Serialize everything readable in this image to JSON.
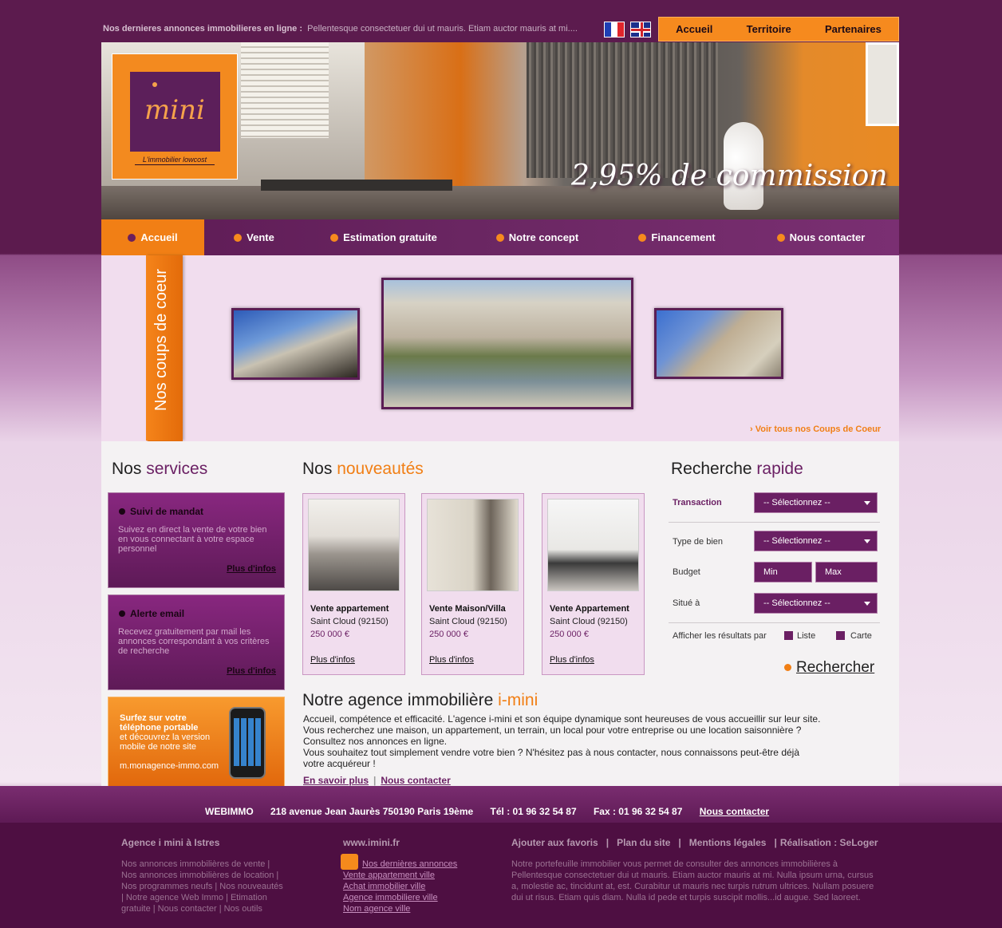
{
  "top": {
    "headline_label": "Nos dernieres annonces immobilieres en ligne",
    "headline_sep": " :",
    "headline_text": "Pellentesque consectetuer dui ut mauris. Etiam auctor mauris at mi....",
    "nav": [
      "Accueil",
      "Territoire",
      "Partenaires"
    ]
  },
  "hero": {
    "logo_word": "mini",
    "logo_tagline": "L'immobilier lowcost",
    "commission": "2,95% de commission"
  },
  "mainnav": [
    "Accueil",
    "Vente",
    "Estimation gratuite",
    "Notre concept",
    "Financement",
    "Nous contacter"
  ],
  "coeur": {
    "tab": "Nos coups de coeur",
    "link": "› Voir tous nos Coups de Coeur"
  },
  "services": {
    "title_a": "Nos ",
    "title_b": "services",
    "items": [
      {
        "title": "Suivi de mandat",
        "desc": "Suivez en direct la vente de votre bien en vous connectant à votre espace personnel",
        "more": "Plus d'infos"
      },
      {
        "title": "Alerte email",
        "desc": "Recevez gratuitement par mail les annonces correspondant à vos critères de recherche",
        "more": "Plus d'infos"
      }
    ],
    "mobile": {
      "title": "Surfez sur votre téléphone portable",
      "desc": "et découvrez la version mobile de notre site",
      "url": "m.monagence-immo.com"
    }
  },
  "nouveautes": {
    "title_a": "Nos ",
    "title_b": "nouveautés",
    "cards": [
      {
        "title": "Vente appartement",
        "city": "Saint Cloud  (92150)",
        "price": "250 000 €",
        "more": "Plus d'infos"
      },
      {
        "title": "Vente Maison/Villa",
        "city": "Saint Cloud  (92150)",
        "price": "250 000 €",
        "more": "Plus d'infos"
      },
      {
        "title": "Vente Appartement",
        "city": "Saint Cloud  (92150)",
        "price": "250 000 €",
        "more": "Plus d'infos"
      }
    ]
  },
  "recherche": {
    "title_a": "Recherche ",
    "title_b": "rapide",
    "transaction_label": "Transaction",
    "type_label": "Type de bien",
    "budget_label": "Budget",
    "situe_label": "Situé à",
    "select_placeholder": "-- Sélectionnez --",
    "min": "Min",
    "max": "Max",
    "afficher_label": "Afficher les résultats par",
    "liste": "Liste",
    "carte": "Carte",
    "button": "Rechercher"
  },
  "agence": {
    "title_a": "Notre agence immobilière ",
    "title_b": "i-mini",
    "lines": [
      "Accueil, compétence et efficacité. L'agence i-mini et son équipe dynamique sont heureuses de vous accueillir sur leur site.",
      "Vous recherchez une maison, un appartement, un terrain, un local pour votre entreprise ou une location saisonnière ?",
      "Consultez nos annonces en ligne.",
      "Vous souhaitez tout simplement vendre votre bien ? N'hésitez pas à nous contacter, nous connaissons peut-être déjà",
      "votre acquéreur !"
    ],
    "link1": "En savoir plus",
    "link2": "Nous contacter"
  },
  "footbar": {
    "brand": "WEBIMMO",
    "address": "218 avenue Jean Jaurès 750190 Paris 19ème",
    "tel": "Tél : 01 96 32 54 87",
    "fax": "Fax : 01 96 32 54 87",
    "contact": "Nous contacter"
  },
  "footer": {
    "col1_title": "Agence i mini à Istres",
    "col1_text": "Nos annonces immobilières de vente | Nos annonces immobilières de location | Nos programmes neufs | Nos nouveautés | Notre agence Web Immo | Etimation gratuite | Nous contacter | Nos outils",
    "col2_title": "www.imini.fr",
    "col2_links": [
      "Nos dernières annonces",
      "Vente appartement ville",
      "Achat immobilier ville",
      "Agence immobiliere ville",
      "Nom agence ville"
    ],
    "col3_links": [
      "Ajouter aux favoris",
      "Plan du site",
      "Mentions légales",
      "Réalisation : SeLoger"
    ],
    "col3_text": "Notre portefeuille immobilier vous permet de consulter des annonces immobilières à Pellentesque consectetuer dui ut mauris. Etiam auctor mauris at mi. Nulla ipsum urna, cursus a, molestie ac, tincidunt at, est. Curabitur ut mauris nec turpis rutrum ultrices. Nullam posuere dui ut risus. Etiam quis diam. Nulla id pede et turpis suscipit mollis...id augue. Sed laoreet."
  }
}
